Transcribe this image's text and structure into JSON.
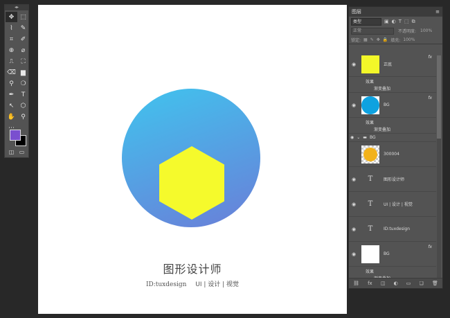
{
  "toolbar": {
    "header": "◂▸",
    "tools": [
      "✥",
      "⬚",
      "⌇",
      "✎",
      "⌗",
      "✐",
      "⊕",
      "⌀",
      "⎍",
      "⛶",
      "⌫",
      "▆",
      "⚲",
      "❍",
      "✒",
      "T",
      "↖",
      "⬡",
      "✋",
      "⚲",
      "⋯",
      ""
    ],
    "fg_color": "#7a4fcf",
    "bg_color": "#000000"
  },
  "canvas": {
    "title": "图形设计师",
    "id_text": "ID:tuxdesign",
    "tagline": "UI | 设计 | 视觉",
    "circle_top_color": "#40c4ee",
    "circle_bottom_color": "#6a7ed8",
    "hexagon_color": "#f5fa2c"
  },
  "layers_panel": {
    "title": "图层",
    "filter_label": "类型",
    "blend_mode": "正常",
    "opacity_label": "不透明度:",
    "opacity_value": "100%",
    "lock_label": "锁定:",
    "fill_label": "填充:",
    "fill_value": "100%",
    "layers": [
      {
        "name": "正底",
        "type": "image",
        "thumb": "yellow",
        "fx": "fx",
        "effects_label": "效果",
        "effect": "渐变叠加"
      },
      {
        "name": "BG",
        "type": "image",
        "thumb": "blue",
        "fx": "fx",
        "effects_label": "效果",
        "effect": "渐变叠加"
      },
      {
        "name": "BG",
        "type": "group"
      },
      {
        "name": "300004",
        "type": "image",
        "thumb": "medal"
      },
      {
        "name": "图形设计师",
        "type": "text"
      },
      {
        "name": "UI | 设计 | 视觉",
        "type": "text"
      },
      {
        "name": "ID:tuxdesign",
        "type": "text"
      },
      {
        "name": "BG",
        "type": "image",
        "thumb": "white",
        "fx": "fx",
        "effects_label": "效果",
        "effect": "渐变叠加"
      }
    ],
    "footer_icons": [
      "⛓",
      "fx",
      "◫",
      "◐",
      "▭",
      "❏",
      "🗑"
    ]
  }
}
